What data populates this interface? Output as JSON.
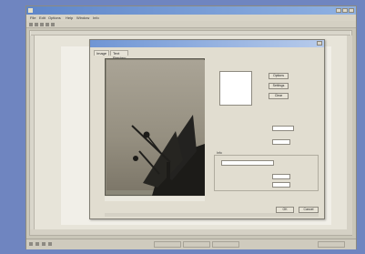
{
  "app": {
    "title": "",
    "menu": [
      "File",
      "Edit",
      "Options",
      "Help",
      "Window",
      "Info"
    ]
  },
  "dialog": {
    "title": "",
    "tabs": [
      "Image",
      "Text Preview"
    ],
    "image_caption": "",
    "section_label": "",
    "list_buttons": [
      "Options",
      "Settings",
      "Clear"
    ],
    "fields": [
      {
        "label": "",
        "value": ""
      },
      {
        "label": "",
        "value": ""
      },
      {
        "label": "",
        "value": ""
      },
      {
        "label": "",
        "value": ""
      }
    ],
    "group_label": "Info",
    "ok_label": "OK",
    "cancel_label": "Cancel"
  },
  "status": {
    "cells": [
      "",
      "",
      "",
      ""
    ]
  },
  "colors": {
    "background": "#6f85c0",
    "title_bar": "#5f86c9",
    "dialog_face": "#e1ddd0"
  }
}
